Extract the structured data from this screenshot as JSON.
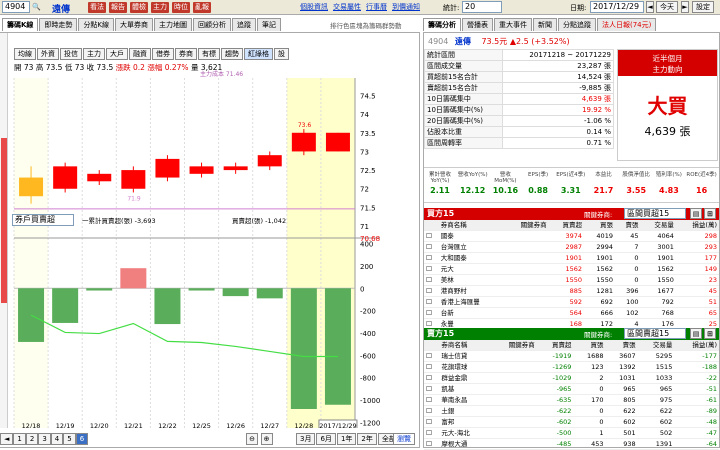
{
  "topbar": {
    "stock": "4904",
    "name": "遠傳",
    "buttons": [
      "看法",
      "報告",
      "體檢",
      "主力",
      "時位",
      "亂報"
    ],
    "links": [
      "個股資訊",
      "交易屬性",
      "行事曆",
      "到價通知"
    ],
    "stats_label": "統計:",
    "stats_value": "20",
    "date_label": "日期:",
    "date_value": "2017/12/29",
    "today": "今天",
    "reset": "設定"
  },
  "left_tabs": [
    "籌碼K線",
    "即時走勢",
    "分點K線",
    "大單券商",
    "主力地圖",
    "回顧分析",
    "追蹤",
    "筆記"
  ],
  "filter_note": "排行色區塊為籌碼群勢動",
  "chart_toolbar": [
    "均線",
    "外資",
    "投信",
    "主力",
    "大戶",
    "融資",
    "借券",
    "券商",
    "有標",
    "趨勢",
    "紅綠格",
    "設"
  ],
  "ohlc": {
    "open_l": "開",
    "open": "73",
    "high_l": "高",
    "high": "73.5",
    "low_l": "低",
    "low": "73",
    "close_l": "收",
    "close": "73.5",
    "chg_l": "漲跌",
    "chg": "0.2",
    "pct_l": "漲幅",
    "pct": "0.27%",
    "vol_l": "量",
    "vol": "3,621"
  },
  "ma_label": "主力成本 71.46",
  "price_axis": [
    "74.5",
    "74",
    "73.5",
    "73",
    "72.5",
    "72",
    "71.5",
    "71",
    "70.68"
  ],
  "price_tag": "73.6",
  "price_tag2": "71.9",
  "lower": {
    "select": "券戶買賣超",
    "legend1": "一累計買賣超(張) -3,693",
    "legend2": "買賣超(張) -1,042",
    "axis": [
      "400",
      "200",
      "0",
      "-200",
      "-400",
      "-600",
      "-800",
      "-1000",
      "-1200"
    ]
  },
  "dates": [
    "12/18",
    "12/19",
    "12/20",
    "12/21",
    "12/22",
    "12/25",
    "12/26",
    "12/27",
    "12/28",
    "2017/12/29"
  ],
  "year": "2017",
  "pager": [
    "1",
    "2",
    "3",
    "4",
    "5",
    "6"
  ],
  "range_buttons": [
    "3月",
    "6月",
    "1年",
    "2年",
    "全部"
  ],
  "bottom_right": "瀏覽",
  "right_tabs": [
    "籌碼分析",
    "營播表",
    "重大事件",
    "新聞",
    "分點追蹤",
    "法人日報(74元)"
  ],
  "quote": {
    "code": "4904",
    "name": "遠傳",
    "price": "73.5元",
    "chg": "▲2.5 (+3.52%)"
  },
  "stats": [
    {
      "k": "統計區間",
      "v": "20171218 ~ 20171229"
    },
    {
      "k": "區間成交量",
      "v": "23,287 張"
    },
    {
      "k": "買超前15名合計",
      "v": "14,524 張"
    },
    {
      "k": "賣超前15名合計",
      "v": "-9,885 張"
    },
    {
      "k": "10日籌碼集中",
      "v": "4,639 張"
    },
    {
      "k": "10日籌碼集中(%)",
      "v": "19.92 %"
    },
    {
      "k": "20日籌碼集中(%)",
      "v": "-1.06 %"
    },
    {
      "k": "佔股本比重",
      "v": "0.14 %"
    },
    {
      "k": "區間周轉率",
      "v": "0.71 %"
    }
  ],
  "signal": {
    "title": "近半個月",
    "sub": "主力動向",
    "big": "大買",
    "amount": "4,639 張"
  },
  "metrics": [
    {
      "k": "累計營收YoY(%)",
      "v": "2.11"
    },
    {
      "k": "營收YoY(%)",
      "v": "12.12"
    },
    {
      "k": "營收MoM(%)",
      "v": "10.16"
    },
    {
      "k": "EPS(季)",
      "v": "0.88"
    },
    {
      "k": "EPS(近4季)",
      "v": "3.31"
    },
    {
      "k": "本益比",
      "v": "21.7"
    },
    {
      "k": "股價淨值比",
      "v": "3.55"
    },
    {
      "k": "殖利率(%)",
      "v": "4.83"
    },
    {
      "k": "ROE(近4季)",
      "v": "16"
    }
  ],
  "buy": {
    "title": "買方15",
    "filter_label": "關鍵券商:",
    "filter": "區間買超15",
    "cols": [
      "券商名稱",
      "關鍵券商",
      "買賣超",
      "買張",
      "賣張",
      "交易量",
      "損益(萬)"
    ],
    "rows": [
      [
        "國泰",
        "",
        3974,
        4019,
        45,
        4064,
        "298"
      ],
      [
        "台灣匯立",
        "",
        2987,
        2994,
        7,
        3001,
        "293"
      ],
      [
        "大和國泰",
        "",
        1901,
        1901,
        0,
        1901,
        "177"
      ],
      [
        "元大",
        "",
        1562,
        1562,
        0,
        1562,
        "149"
      ],
      [
        "美林",
        "",
        1550,
        1550,
        0,
        1550,
        "23"
      ],
      [
        "港商野村",
        "",
        885,
        1281,
        396,
        1677,
        "45"
      ],
      [
        "香港上海匯豐",
        "",
        592,
        692,
        100,
        792,
        "51"
      ],
      [
        "台新",
        "",
        564,
        666,
        102,
        768,
        "65"
      ],
      [
        "永豐",
        "",
        168,
        172,
        4,
        176,
        "25"
      ]
    ]
  },
  "sell": {
    "title": "賣方15",
    "filter_label": "關鍵券商:",
    "filter": "區間賣超15",
    "cols": [
      "券商名稱",
      "關鍵券商",
      "買賣超",
      "買張",
      "賣張",
      "交易量",
      "損益(萬)"
    ],
    "rows": [
      [
        "瑞士信貸",
        "",
        -1919,
        1688,
        3607,
        5295,
        "-177"
      ],
      [
        "花旗環球",
        "",
        -1269,
        123,
        1392,
        1515,
        "-188"
      ],
      [
        "群益金鼎",
        "",
        -1029,
        2,
        1031,
        1033,
        "-22"
      ],
      [
        "凱基",
        "",
        -965,
        0,
        965,
        965,
        "-51"
      ],
      [
        "華南永昌",
        "",
        -635,
        170,
        805,
        975,
        "-61"
      ],
      [
        "土銀",
        "",
        -622,
        0,
        622,
        622,
        "-89"
      ],
      [
        "富邦",
        "",
        -602,
        0,
        602,
        602,
        "-48"
      ],
      [
        "元大-海北",
        "",
        -500,
        1,
        501,
        502,
        "-47"
      ],
      [
        "摩根大通",
        "",
        -485,
        453,
        938,
        1391,
        "-64"
      ]
    ]
  },
  "colors": {
    "up": "#ff0000",
    "down": "#008000",
    "band": "#ffffcc"
  },
  "chart_data": {
    "type": "bar",
    "categories": [
      "12/18",
      "12/19",
      "12/20",
      "12/21",
      "12/22",
      "12/25",
      "12/26",
      "12/27",
      "12/28",
      "2017/12/29"
    ],
    "candles": [
      {
        "o": 72.3,
        "c": 71.8,
        "h": 72.6,
        "l": 71.6
      },
      {
        "o": 72.0,
        "c": 72.6,
        "h": 72.7,
        "l": 71.9
      },
      {
        "o": 72.4,
        "c": 72.2,
        "h": 72.5,
        "l": 72.1
      },
      {
        "o": 72.0,
        "c": 72.5,
        "h": 72.6,
        "l": 71.9
      },
      {
        "o": 72.3,
        "c": 72.8,
        "h": 72.9,
        "l": 72.2
      },
      {
        "o": 72.6,
        "c": 72.4,
        "h": 72.7,
        "l": 72.3
      },
      {
        "o": 72.5,
        "c": 72.6,
        "h": 72.7,
        "l": 72.4
      },
      {
        "o": 72.6,
        "c": 72.9,
        "h": 73.0,
        "l": 72.5
      },
      {
        "o": 73.0,
        "c": 73.5,
        "h": 73.6,
        "l": 72.9
      },
      {
        "o": 73.0,
        "c": 73.5,
        "h": 73.5,
        "l": 73.0
      }
    ],
    "values": [
      -480,
      -310,
      -20,
      180,
      -320,
      -20,
      -70,
      -90,
      -1080,
      -1042
    ],
    "cumulative": [
      -480,
      -790,
      -810,
      -630,
      -950,
      -970,
      -1040,
      -1130,
      -2210,
      -3693
    ],
    "ylim_price": [
      70.68,
      74.7
    ],
    "ylim_lower": [
      -1250,
      450
    ]
  }
}
